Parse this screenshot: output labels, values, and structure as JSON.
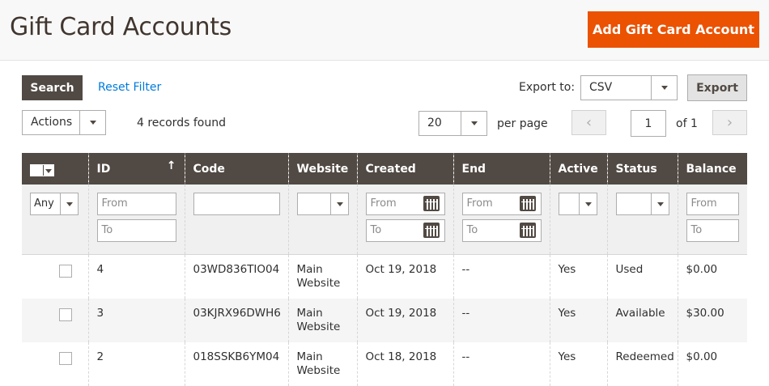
{
  "header": {
    "title": "Gift Card Accounts",
    "add_button_label": "Add Gift Card Account",
    "accent_color": "#eb5202"
  },
  "toolbar": {
    "search_label": "Search",
    "reset_filter_label": "Reset Filter",
    "export_to_label": "Export to:",
    "export_format": "CSV",
    "export_button_label": "Export",
    "actions_label": "Actions",
    "records_found": "4 records found",
    "page_size": "20",
    "per_page_label": "per page",
    "current_page": "1",
    "of_pages": "of 1",
    "prev_icon": "chevron-left-icon",
    "next_icon": "chevron-right-icon"
  },
  "grid": {
    "columns": [
      "",
      "ID",
      "Code",
      "Website",
      "Created",
      "End",
      "Active",
      "Status",
      "Balance"
    ],
    "sort_indicator": "↑",
    "filters": {
      "any": "Any",
      "from": "From",
      "to": "To"
    },
    "rows": [
      {
        "id": "4",
        "code": "03WD836TIO04",
        "website": "Main Website",
        "created": "Oct 19, 2018",
        "end": "--",
        "active": "Yes",
        "status": "Used",
        "balance": "$0.00"
      },
      {
        "id": "3",
        "code": "03KJRX96DWH6",
        "website": "Main Website",
        "created": "Oct 19, 2018",
        "end": "--",
        "active": "Yes",
        "status": "Available",
        "balance": "$30.00"
      },
      {
        "id": "2",
        "code": "018SSKB6YM04",
        "website": "Main Website",
        "created": "Oct 18, 2018",
        "end": "--",
        "active": "Yes",
        "status": "Redeemed",
        "balance": "$0.00"
      }
    ]
  }
}
